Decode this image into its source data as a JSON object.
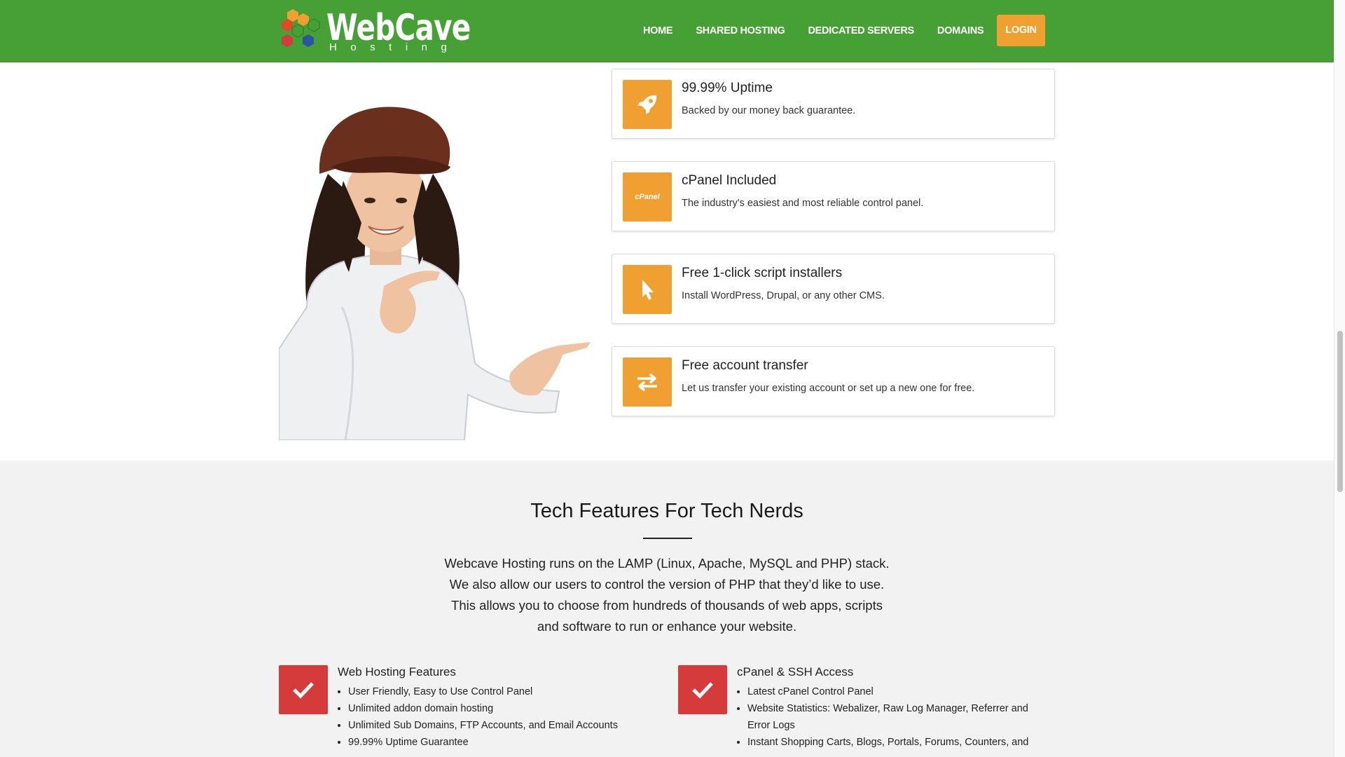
{
  "brand": {
    "name": "WebCave",
    "sub": "Hosting",
    "hex_colors": [
      "#f0a030",
      "#e04a2a",
      "#46a035",
      "#2a54a4",
      "#d63b3b"
    ]
  },
  "nav": {
    "items": [
      {
        "label": "HOME"
      },
      {
        "label": "SHARED HOSTING"
      },
      {
        "label": "DEDICATED SERVERS"
      },
      {
        "label": "DOMAINS"
      }
    ],
    "login": "LOGIN"
  },
  "features": [
    {
      "icon": "rocket-icon",
      "title": "99.99% Uptime",
      "desc": "Backed by our money back guarantee."
    },
    {
      "icon": "cpanel-icon",
      "icon_text": "cPanel",
      "title": "cPanel Included",
      "desc": "The industry's easiest and most reliable control panel."
    },
    {
      "icon": "cursor-icon",
      "title": "Free 1-click script installers",
      "desc": "Install WordPress, Drupal, or any other CMS."
    },
    {
      "icon": "transfer-icon",
      "title": "Free account transfer",
      "desc": "Let us transfer your existing account or set up a new one for free."
    }
  ],
  "tech": {
    "title": "Tech Features For Tech Nerds",
    "lines": [
      "Webcave Hosting runs on the LAMP (Linux, Apache, MySQL and PHP) stack.",
      "We also allow our users to control the version of PHP that they’d like to use.",
      "This allows you to choose from hundreds of thousands of web apps, scripts",
      "and software to run or enhance your website."
    ],
    "blocks": [
      {
        "title": "Web Hosting Features",
        "items": [
          "User Friendly, Easy to Use Control Panel",
          "Unlimited addon domain hosting",
          "Unlimited Sub Domains, FTP Accounts, and Email Accounts",
          "99.99% Uptime Guarantee"
        ]
      },
      {
        "title": "cPanel & SSH Access",
        "items": [
          "Latest cPanel Control Panel",
          "Website Statistics: Webalizer, Raw Log Manager, Referrer and Error Logs",
          "Instant Shopping Carts, Blogs, Portals, Forums, Counters, and"
        ]
      }
    ]
  },
  "colors": {
    "nav_bg": "#46a035",
    "accent_orange": "#f0a030",
    "check_red": "#d63b3b",
    "section_bg": "#f2f2f2"
  }
}
